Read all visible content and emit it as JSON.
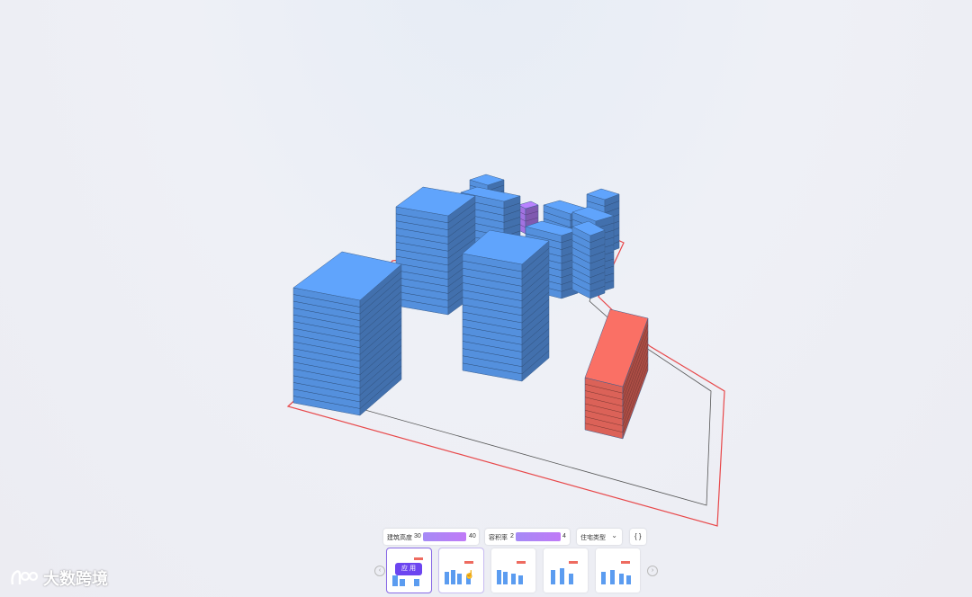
{
  "toolbar": {
    "param1": {
      "label": "建筑高度",
      "min": "30",
      "max": "40"
    },
    "param2": {
      "label": "容积率",
      "min": "2",
      "max": "4"
    },
    "select": {
      "value": "住宅类型"
    },
    "extra_icon": "brackets-icon"
  },
  "thumbnails": {
    "apply_label": "应 用",
    "prev_icon": "chevron-left-icon",
    "next_icon": "chevron-right-icon",
    "count": 5
  },
  "watermark": {
    "text": "大数跨境",
    "logo_icon": "dashujukuajing-logo"
  },
  "colors": {
    "building_blue": "#5b9cf0",
    "building_red": "#ee6b60",
    "building_purple": "#b07cf5",
    "boundary_red": "#e8484a",
    "accent": "#6c45f0"
  }
}
